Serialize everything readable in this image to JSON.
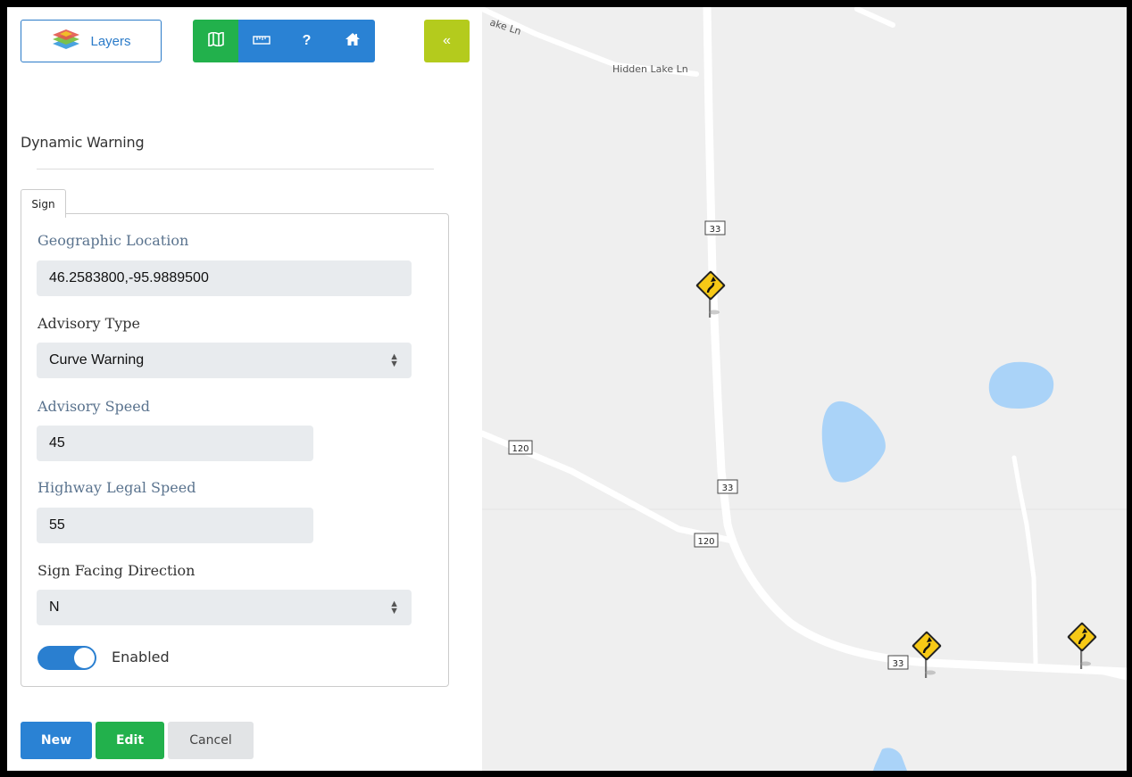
{
  "toolbar": {
    "layers_label": "Layers",
    "map_icon": "map-icon",
    "ruler_icon": "ruler-icon",
    "help_label": "?",
    "home_icon": "home-icon",
    "collapse_label": "«"
  },
  "panel": {
    "title": "Dynamic Warning",
    "tabs": [
      {
        "label": "Sign"
      }
    ],
    "fields": {
      "geo_location": {
        "label": "Geographic Location",
        "value": "46.2583800,-95.9889500"
      },
      "advisory_type": {
        "label": "Advisory Type",
        "value": "Curve Warning"
      },
      "advisory_speed": {
        "label": "Advisory Speed",
        "value": "45"
      },
      "highway_legal_speed": {
        "label": "Highway Legal Speed",
        "value": "55"
      },
      "sign_facing_direction": {
        "label": "Sign Facing Direction",
        "value": "N"
      }
    },
    "enabled": {
      "label": "Enabled",
      "on": true
    }
  },
  "actions": {
    "new_label": "New",
    "edit_label": "Edit",
    "cancel_label": "Cancel"
  },
  "map": {
    "road_labels": {
      "lake_ln_partial": "ake Ln",
      "hidden_lake_ln": "Hidden Lake Ln"
    },
    "route_shields": [
      "33",
      "33",
      "33",
      "120",
      "120"
    ],
    "sign_icon": "curve-warning-sign-icon",
    "colors": {
      "background": "#efefef",
      "road": "#ffffff",
      "water": "#aad3f8",
      "sign": "#f7c916"
    }
  }
}
